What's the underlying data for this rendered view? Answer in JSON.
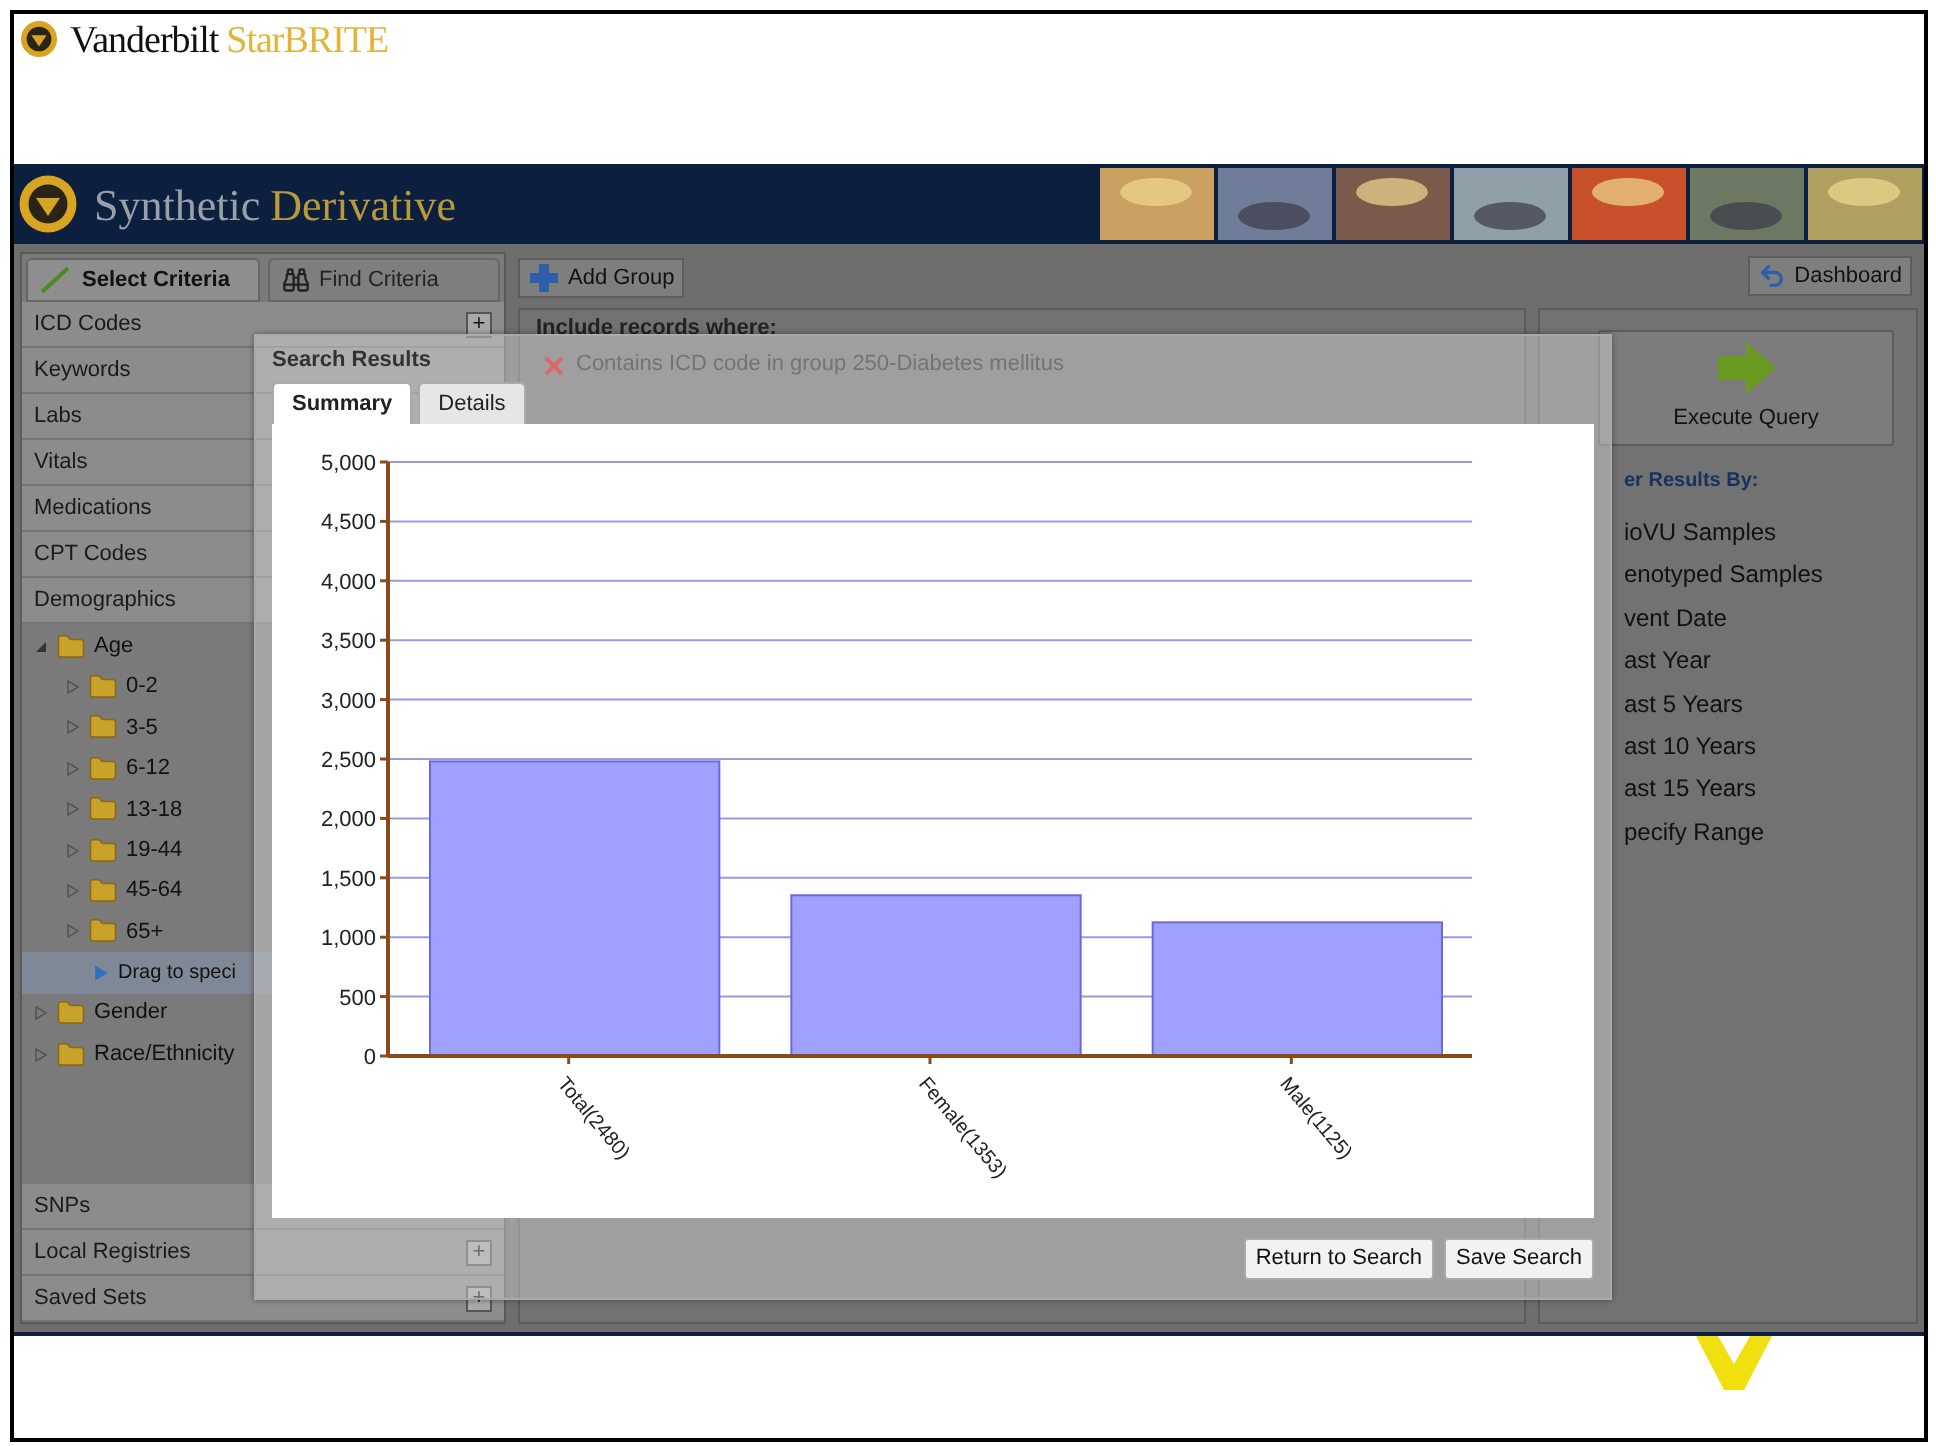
{
  "site_header": {
    "brand": "Vanderbilt",
    "product": "StarBRITE"
  },
  "app_header": {
    "name_first": "Synthetic",
    "name_second": "Derivative"
  },
  "sidebar": {
    "tabs": [
      {
        "label": "Select Criteria",
        "selected": true
      },
      {
        "label": "Find Criteria",
        "selected": false
      }
    ],
    "categories": [
      {
        "label": "ICD Codes",
        "add": "+"
      },
      {
        "label": "Keywords"
      },
      {
        "label": "Labs"
      },
      {
        "label": "Vitals"
      },
      {
        "label": "Medications"
      },
      {
        "label": "CPT Codes"
      },
      {
        "label": "Demographics"
      }
    ],
    "tree": [
      {
        "kind": "folder",
        "label": "Age",
        "expanded": true,
        "children": [
          {
            "kind": "folder",
            "label": "0-2",
            "expanded": false
          },
          {
            "kind": "folder",
            "label": "3-5",
            "expanded": false
          },
          {
            "kind": "folder",
            "label": "6-12",
            "expanded": false
          },
          {
            "kind": "folder",
            "label": "13-18",
            "expanded": false
          },
          {
            "kind": "folder",
            "label": "19-44",
            "expanded": false
          },
          {
            "kind": "folder",
            "label": "45-64",
            "expanded": false
          },
          {
            "kind": "folder",
            "label": "65+",
            "expanded": false
          },
          {
            "kind": "hint",
            "label": "Drag to speci"
          }
        ]
      },
      {
        "kind": "folder",
        "label": "Gender",
        "expanded": false
      },
      {
        "kind": "folder",
        "label": "Race/Ethnicity",
        "expanded": false
      }
    ],
    "bottom_categories": [
      {
        "label": "SNPs"
      },
      {
        "label": "Local Registries",
        "add": "+"
      },
      {
        "label": "Saved Sets",
        "add": "+"
      }
    ]
  },
  "query": {
    "add_group": "Add Group",
    "heading": "Include records where:",
    "conditions": [
      {
        "text": "Contains ICD code in group 250-Diabetes mellitus"
      }
    ]
  },
  "dashboard": "Dashboard",
  "execute": "Execute Query",
  "filter": {
    "heading": "er Results By:",
    "options": [
      "ioVU Samples",
      "enotyped Samples",
      "vent Date",
      "ast Year",
      "ast 5 Years",
      "ast 10 Years",
      "ast 15 Years",
      "pecify Range"
    ]
  },
  "dialog": {
    "title": "Search Results",
    "tabs": [
      {
        "label": "Summary",
        "selected": true
      },
      {
        "label": "Details",
        "selected": false
      }
    ],
    "chart_data": {
      "type": "bar",
      "categories": [
        "Total(2480)",
        "Female(1353)",
        "Male(1125)"
      ],
      "values": [
        2480,
        1353,
        1125
      ],
      "grid": true,
      "ylim": [
        0,
        5000
      ],
      "yticks": [
        {
          "value": 0,
          "label": "0"
        },
        {
          "value": 500,
          "label": "500"
        },
        {
          "value": 1000,
          "label": "1,000"
        },
        {
          "value": 1500,
          "label": "1,500"
        },
        {
          "value": 2000,
          "label": "2,000"
        },
        {
          "value": 2500,
          "label": "2,500"
        },
        {
          "value": 3000,
          "label": "3,000"
        },
        {
          "value": 3500,
          "label": "3,500"
        },
        {
          "value": 4000,
          "label": "4,000"
        },
        {
          "value": 4500,
          "label": "4,500"
        },
        {
          "value": 5000,
          "label": "5,000"
        }
      ]
    },
    "buttons": [
      "Return to Search",
      "Save Search"
    ]
  }
}
